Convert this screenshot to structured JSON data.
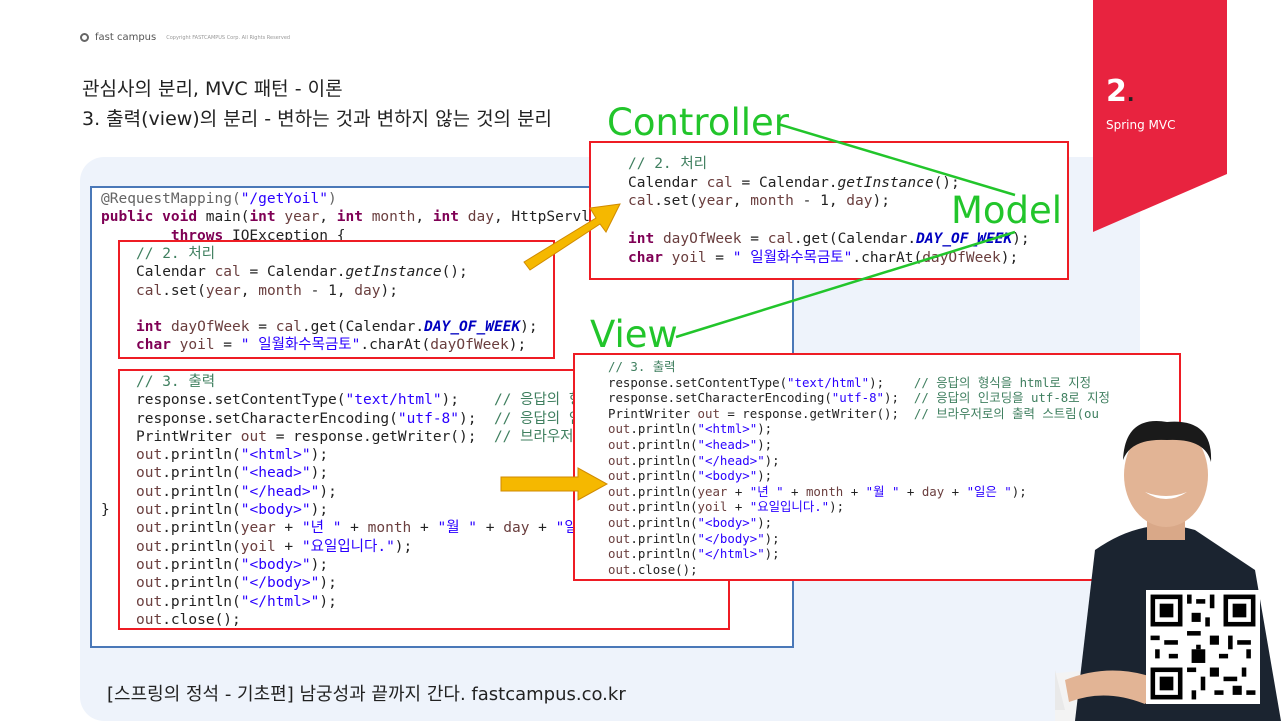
{
  "header": {
    "brand": "fast campus",
    "copyright": "Copyright FASTCAMPUS Corp. All Rights Reserved",
    "title_line1": "관심사의 분리, MVC 패턴 - 이론",
    "title_line2": "3. 출력(view)의 분리 - 변하는 것과 변하지 않는 것의 분리"
  },
  "section": {
    "number": "2",
    "dot": ".",
    "name": "Spring MVC"
  },
  "labels": {
    "controller": "Controller",
    "model": "Model",
    "view": "View"
  },
  "footer": {
    "text": "[스프링의 정석 - 기초편] 남궁성과 끝까지 간다.  fastcampus.co.kr"
  },
  "colors": {
    "accent_red": "#e8233f",
    "label_green": "#22c52b",
    "arrow_orange": "#f5b800",
    "box_red": "#ee1c24",
    "box_blue": "#4a78b8"
  },
  "icons": [
    "fastcampus-logo-icon",
    "arrow-right-icon",
    "qr-code"
  ]
}
